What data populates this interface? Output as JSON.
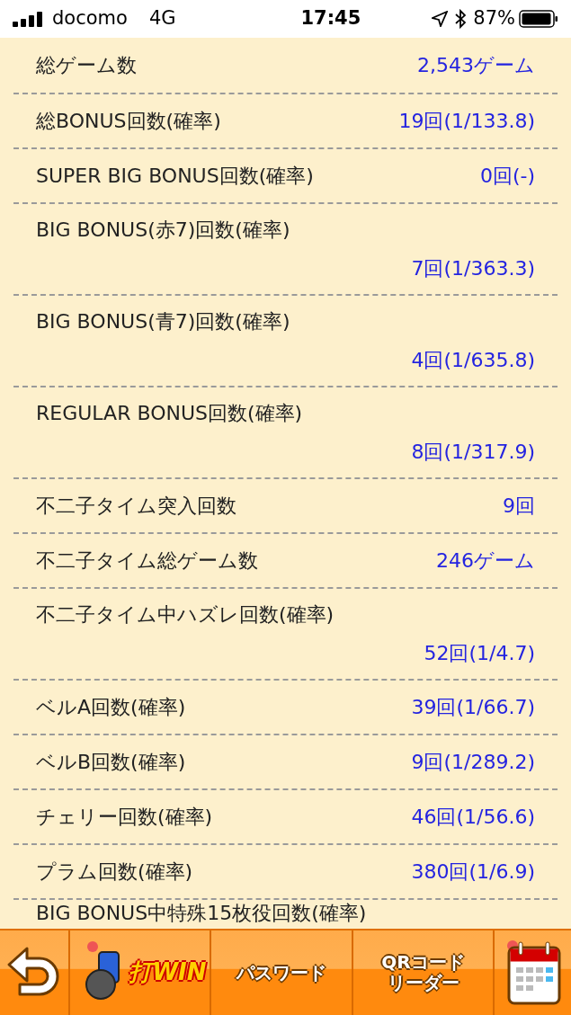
{
  "status_bar": {
    "carrier": "docomo",
    "network": "4G",
    "time": "17:45",
    "battery_percent": "87%"
  },
  "stats": [
    {
      "label": "総ゲーム数",
      "value": "2,543ゲーム",
      "kind": "inline"
    },
    {
      "label": "総BONUS回数(確率)",
      "value": "19回(1/133.8)",
      "kind": "inline"
    },
    {
      "label": "SUPER BIG BONUS回数(確率)",
      "value": "0回(-)",
      "kind": "inline"
    },
    {
      "label": "BIG BONUS(赤7)回数(確率)",
      "value": "7回(1/363.3)",
      "kind": "stacked"
    },
    {
      "label": "BIG BONUS(青7)回数(確率)",
      "value": "4回(1/635.8)",
      "kind": "stacked"
    },
    {
      "label": "REGULAR BONUS回数(確率)",
      "value": "8回(1/317.9)",
      "kind": "stacked"
    },
    {
      "label": "不二子タイム突入回数",
      "value": "9回",
      "kind": "inline"
    },
    {
      "label": "不二子タイム総ゲーム数",
      "value": "246ゲーム",
      "kind": "inline"
    },
    {
      "label": "不二子タイム中ハズレ回数(確率)",
      "value": "52回(1/4.7)",
      "kind": "stacked"
    },
    {
      "label": "ベルA回数(確率)",
      "value": "39回(1/66.7)",
      "kind": "inline"
    },
    {
      "label": "ベルB回数(確率)",
      "value": "9回(1/289.2)",
      "kind": "inline"
    },
    {
      "label": "チェリー回数(確率)",
      "value": "46回(1/56.6)",
      "kind": "inline"
    },
    {
      "label": "プラム回数(確率)",
      "value": "380回(1/6.9)",
      "kind": "inline"
    },
    {
      "label": "BIG BONUS中特殊15枚役回数(確率)",
      "kind": "cut"
    }
  ],
  "toolbar": {
    "logo_text": "打WIN",
    "password_button": "パスワード",
    "qr_button": [
      "QRコード",
      "リーダー"
    ]
  }
}
